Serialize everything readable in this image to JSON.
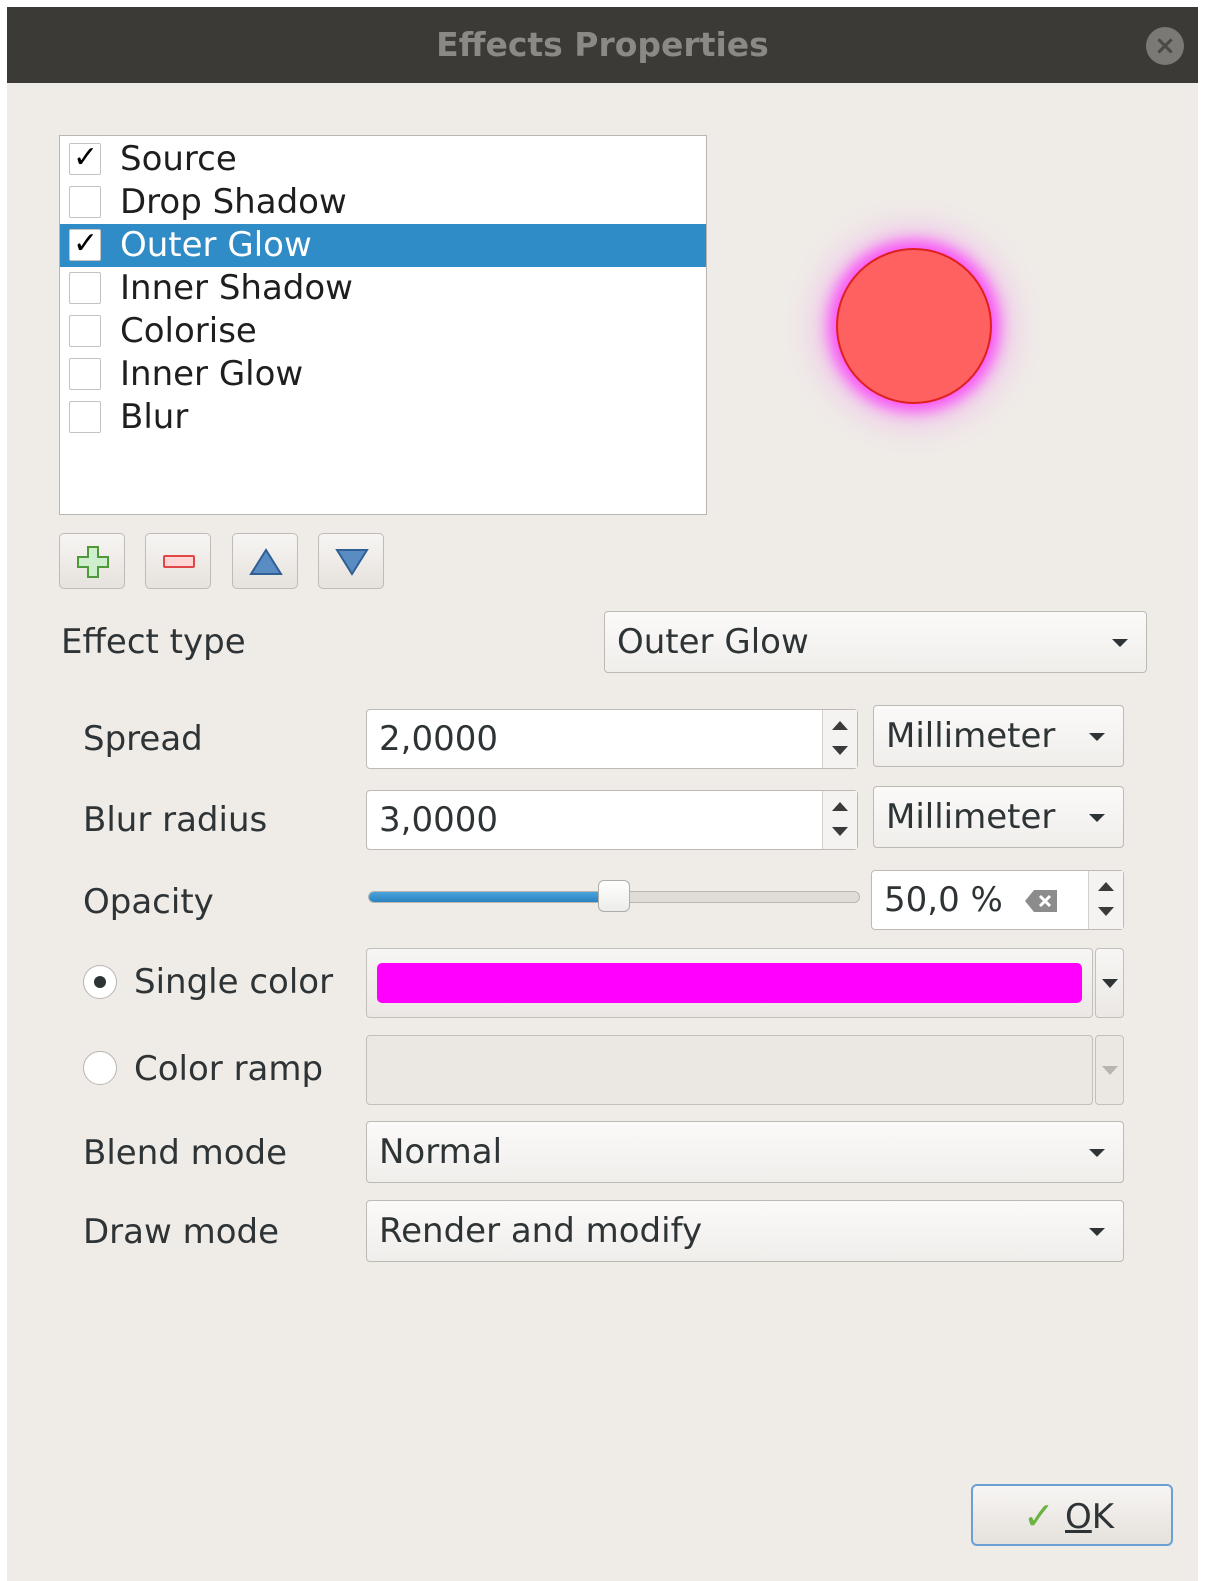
{
  "window": {
    "title": "Effects Properties",
    "close_icon": "close-icon"
  },
  "effects_list": {
    "items": [
      {
        "label": "Source",
        "checked": true,
        "selected": false
      },
      {
        "label": "Drop Shadow",
        "checked": false,
        "selected": false
      },
      {
        "label": "Outer Glow",
        "checked": true,
        "selected": true
      },
      {
        "label": "Inner Shadow",
        "checked": false,
        "selected": false
      },
      {
        "label": "Colorise",
        "checked": false,
        "selected": false
      },
      {
        "label": "Inner Glow",
        "checked": false,
        "selected": false
      },
      {
        "label": "Blur",
        "checked": false,
        "selected": false
      }
    ]
  },
  "preview": {
    "fill_color": "#ff6060",
    "glow_color": "#ff00ff"
  },
  "toolbar": {
    "add_icon": "plus-icon",
    "remove_icon": "minus-icon",
    "up_icon": "arrow-up-icon",
    "down_icon": "arrow-down-icon"
  },
  "effect_type": {
    "label": "Effect type",
    "value": "Outer Glow"
  },
  "spread": {
    "label": "Spread",
    "value": "2,0000",
    "unit": "Millimeter"
  },
  "blur_radius": {
    "label": "Blur radius",
    "value": "3,0000",
    "unit": "Millimeter"
  },
  "opacity": {
    "label": "Opacity",
    "value": "50,0 %",
    "level": 0.5,
    "clear_icon": "backspace-clear-icon"
  },
  "single_color": {
    "label": "Single color",
    "selected": true,
    "color": "#ff00ff"
  },
  "color_ramp": {
    "label": "Color ramp",
    "selected": false
  },
  "blend_mode": {
    "label": "Blend mode",
    "value": "Normal"
  },
  "draw_mode": {
    "label": "Draw mode",
    "value": "Render and modify"
  },
  "ok_button": {
    "label": "OK",
    "icon": "checkmark-icon"
  },
  "colors": {
    "selection": "#308cc6",
    "titlebar": "#3b3a37",
    "background": "#efebe7"
  }
}
